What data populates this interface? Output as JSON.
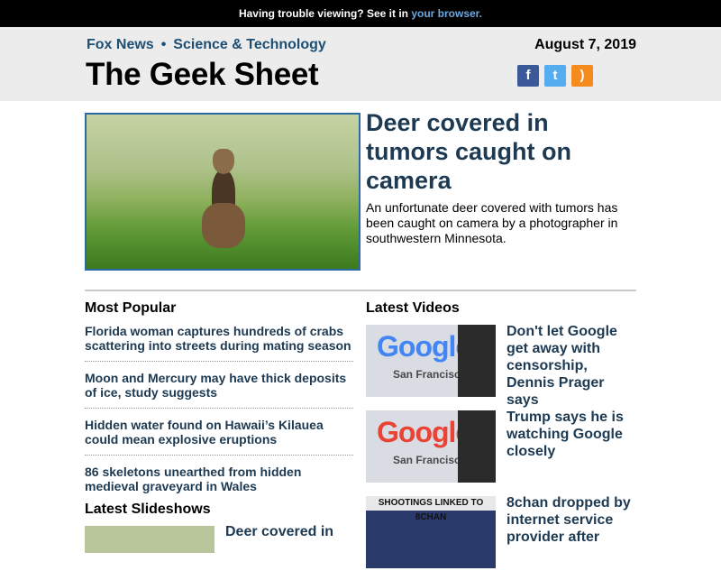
{
  "topbar": {
    "text": "Having trouble viewing? See it in ",
    "link": "your browser."
  },
  "header": {
    "crumbs": [
      "Fox News",
      "Science & Technology"
    ],
    "separator": "•",
    "date": "August 7, 2019",
    "title": "The Geek Sheet",
    "social": [
      {
        "icon": "facebook-icon",
        "glyph": "f"
      },
      {
        "icon": "twitter-icon",
        "glyph": "t"
      },
      {
        "icon": "rss-icon",
        "glyph": ")"
      }
    ]
  },
  "hero": {
    "title": "Deer covered in tumors caught on camera",
    "description": "An unfortunate deer covered with tumors has been caught on camera by a photographer in southwestern Minnesota."
  },
  "most_popular": {
    "heading": "Most Popular",
    "items": [
      "Florida woman captures hundreds of crabs scattering into streets during mating season",
      "Moon and Mercury may have thick deposits of ice, study suggests",
      "Hidden water found on Hawaii’s Kilauea could mean explosive eruptions",
      "86 skeletons unearthed from hidden medieval graveyard in Wales"
    ]
  },
  "latest_videos": {
    "heading": "Latest Videos",
    "items": [
      {
        "title": "Don't let Google get away with censorship, Dennis Prager says",
        "thumb_logo": "Google",
        "thumb_caption": "San Francisco"
      },
      {
        "title": "Trump says he is watching Google closely",
        "thumb_logo": "Google",
        "thumb_caption": "San Francisco"
      },
      {
        "title": "8chan dropped by internet service provider after",
        "thumb_caption": "SHOOTINGS LINKED TO 8CHAN"
      }
    ]
  },
  "latest_slideshows": {
    "heading": "Latest Slideshows",
    "items": [
      {
        "title": "Deer covered in"
      }
    ]
  },
  "colors": {
    "topbar_bg": "#000000",
    "header_bg": "#ececec",
    "link_blue": "#1d3a52",
    "accent_blue": "#2b6aa3"
  }
}
